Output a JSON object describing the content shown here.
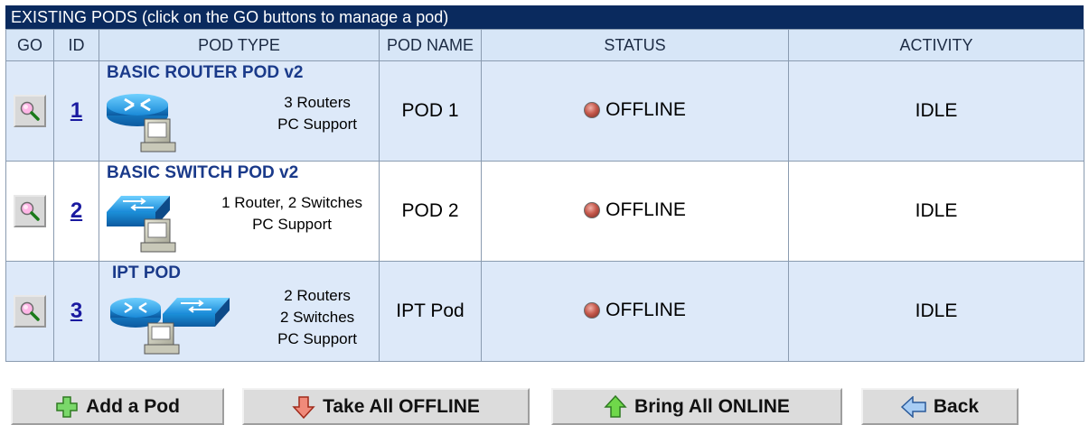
{
  "panel": {
    "title": "EXISTING PODS   (click on the GO buttons to manage a pod)",
    "columns": {
      "go": "GO",
      "id": "ID",
      "pod_type": "POD TYPE",
      "pod_name": "POD NAME",
      "status": "STATUS",
      "activity": "ACTIVITY"
    }
  },
  "pods": [
    {
      "id": "1",
      "type_name": "BASIC ROUTER POD v2",
      "desc_line1": "3 Routers",
      "desc_line2": "PC Support",
      "icon": "router-pc-icon",
      "name": "POD 1",
      "status": "OFFLINE",
      "activity": "IDLE"
    },
    {
      "id": "2",
      "type_name": "BASIC SWITCH POD v2",
      "desc_line1": "1 Router, 2 Switches",
      "desc_line2": "PC Support",
      "icon": "switch-pc-icon",
      "name": "POD 2",
      "status": "OFFLINE",
      "activity": "IDLE"
    },
    {
      "id": "3",
      "type_name": "IPT POD",
      "desc_line1": "2 Routers",
      "desc_line2": "2 Switches",
      "desc_line3": "PC Support",
      "icon": "router-switch-pc-icon",
      "name": "IPT Pod",
      "status": "OFFLINE",
      "activity": "IDLE"
    }
  ],
  "actions": {
    "add_pod": "Add a Pod",
    "take_offline": "Take All OFFLINE",
    "bring_online": "Bring All ONLINE",
    "back": "Back"
  },
  "colors": {
    "title_bar": "#0a2a5e",
    "row_alt": "#dde9f9",
    "header_bg": "#d7e6f7",
    "link": "#1a1aa0",
    "status_led": "#c65a4d"
  }
}
